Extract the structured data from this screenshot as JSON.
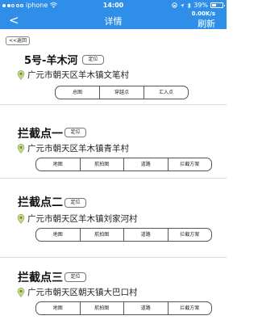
{
  "status_bar": {
    "carrier": "iphone",
    "time": "14:00",
    "battery": "39%"
  },
  "nav": {
    "back_label": "<",
    "title": "详情",
    "speed": "0.00K/s",
    "refresh": "刷新"
  },
  "return_label": "<<返回",
  "header_card": {
    "title": "5号-羊木河",
    "locate": "定位",
    "address": "广元市朝天区羊木镇文笔村",
    "buttons": [
      "总图",
      "穿越点",
      "汇入点"
    ]
  },
  "intercept_points": [
    {
      "title": "拦截点一",
      "locate": "定位",
      "address": "广元市朝天区羊木镇青羊村",
      "buttons": [
        "地图",
        "航拍图",
        "道路",
        "拦截方案"
      ]
    },
    {
      "title": "拦截点二",
      "locate": "定位",
      "address": "广元市朝天区羊木镇刘家河村",
      "buttons": [
        "地图",
        "航拍图",
        "道路",
        "拦截方案"
      ]
    },
    {
      "title": "拦截点三",
      "locate": "定位",
      "address": "广元市朝天区朝天镇大巴口村",
      "buttons": [
        "地图",
        "航拍图",
        "道路",
        "拦截方案"
      ]
    }
  ]
}
